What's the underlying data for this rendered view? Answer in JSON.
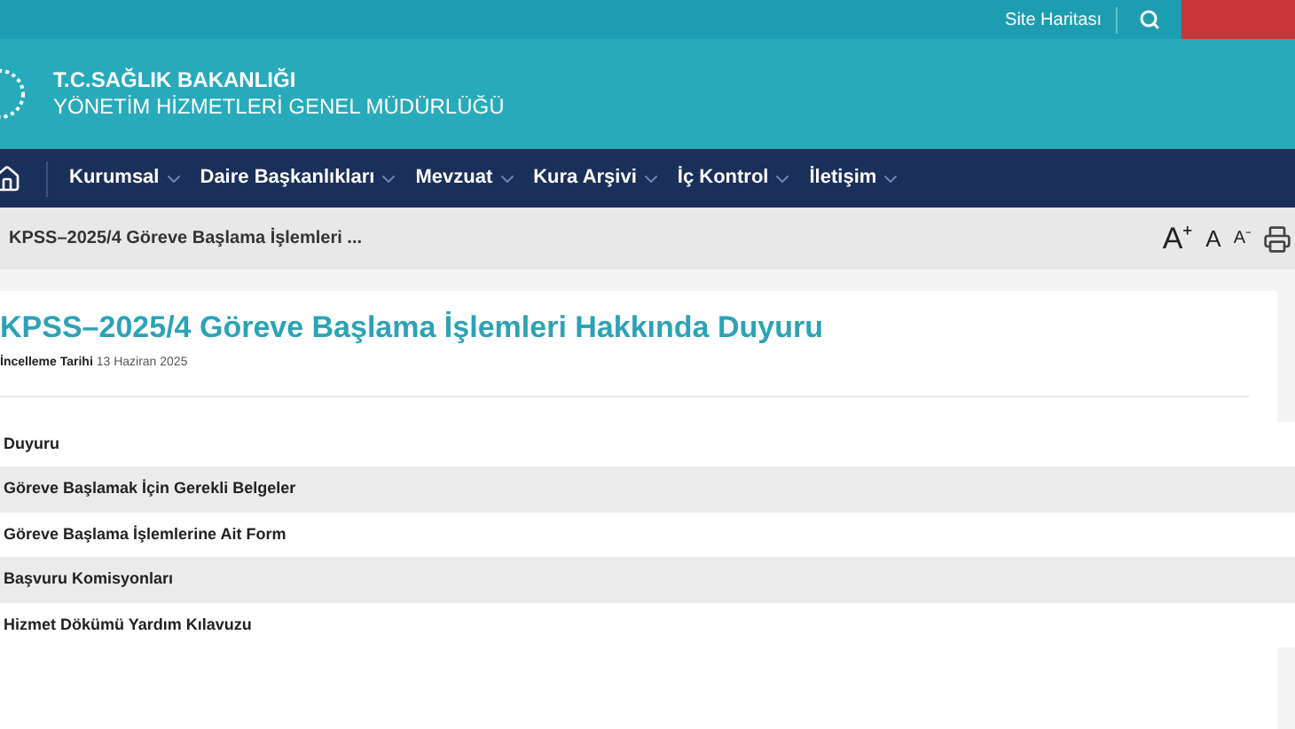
{
  "top_bar": {
    "links": [
      "Site Haritası"
    ]
  },
  "header": {
    "title": "T.C.SAĞLIK BAKANLIĞI",
    "subtitle": "YÖNETİM HİZMETLERİ GENEL MÜDÜRLÜĞÜ"
  },
  "nav": {
    "items": [
      "Kurumsal",
      "Daire Başkanlıkları",
      "Mevzuat",
      "Kura Arşivi",
      "İç Kontrol",
      "İletişim"
    ]
  },
  "breadcrumb": {
    "current": "KPSS–2025/4 Göreve Başlama İşlemleri ..."
  },
  "font_controls": [
    {
      "kind": "large",
      "label": "A⁺"
    },
    {
      "kind": "normal",
      "label": "A"
    },
    {
      "kind": "small",
      "label": "A⁻"
    }
  ],
  "article": {
    "title": "KPSS–2025/4 Göreve Başlama İşlemleri Hakkında Duyuru",
    "date_label": "İncelleme Tarihi",
    "date": "13 Haziran 2025"
  },
  "attachments": [
    {
      "label": "Duyuru"
    },
    {
      "label": "Göreve Başlamak İçin Gerekli Belgeler"
    },
    {
      "label": "Göreve Başlama İşlemlerine Ait Form"
    },
    {
      "label": "Başvuru Komisyonları"
    },
    {
      "label": "Hizmet Dökümü Yardım Kılavuzu"
    }
  ]
}
